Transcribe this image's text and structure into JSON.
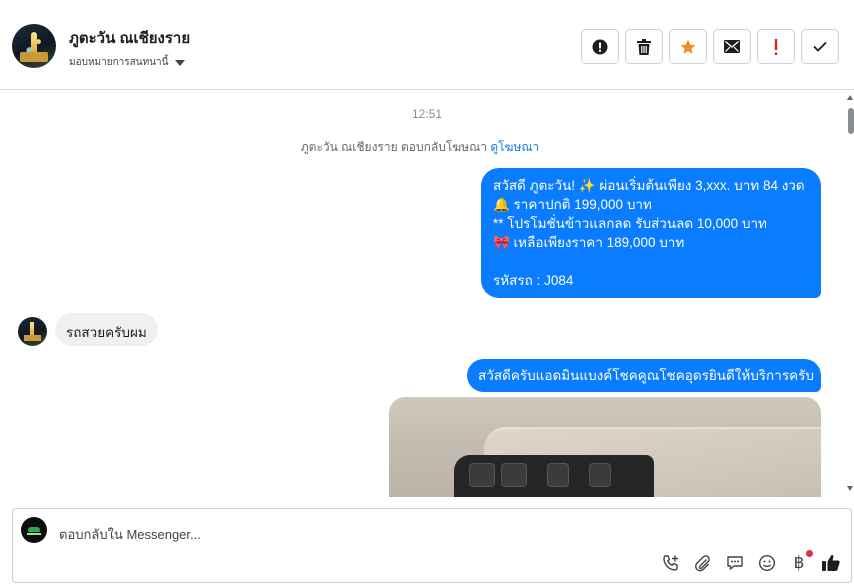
{
  "header": {
    "name": "ภูตะวัน ณเชียงราย",
    "assign_label": "มอบหมายการสนทนานี้"
  },
  "toolbar": {
    "buttons": [
      {
        "icon": "exclamation-circle-icon"
      },
      {
        "icon": "trash-icon"
      },
      {
        "icon": "star-icon",
        "color": "#f38b2a"
      },
      {
        "icon": "envelope-icon"
      },
      {
        "icon": "red-exclamation-icon",
        "color": "#e0201c"
      },
      {
        "icon": "check-icon"
      }
    ]
  },
  "chat": {
    "timestamp": "12:51",
    "system_line": {
      "text": "ภูตะวัน ณเชียงราย ตอบกลับโฆษณา",
      "link": "ดูโฆษณา"
    },
    "messages": {
      "outgoing_1": {
        "line1": "สวัสดี ภูตะวัน! ✨  ผ่อนเริ่มต้นเพียง 3,xxx. บาท 84 งวด",
        "line2": "🔔 ราคาปกติ 199,000 บาท",
        "line3": "** โปรโมชั่นข้าวแลกลด รับส่วนลด 10,000 บาท",
        "line4": "🎀  เหลือเพียงราคา 189,000 บาท",
        "line5": " รหัสรถ : J084"
      },
      "incoming_1": "รถสวยครับผม",
      "outgoing_2": "สวัสดีครับแอดมินแบงค์โชคคูณโชคอุดรยินดีให้บริการครับ"
    }
  },
  "composer": {
    "placeholder": "ตอบกลับใน Messenger...",
    "actions": [
      "add-call-icon",
      "attachment-icon",
      "saved-reply-icon",
      "emoji-icon",
      "payment-baht-icon",
      "like-icon"
    ]
  },
  "colors": {
    "accent": "#0a7cff",
    "link": "#1877f2",
    "incoming_bubble": "#f0f0f0"
  }
}
